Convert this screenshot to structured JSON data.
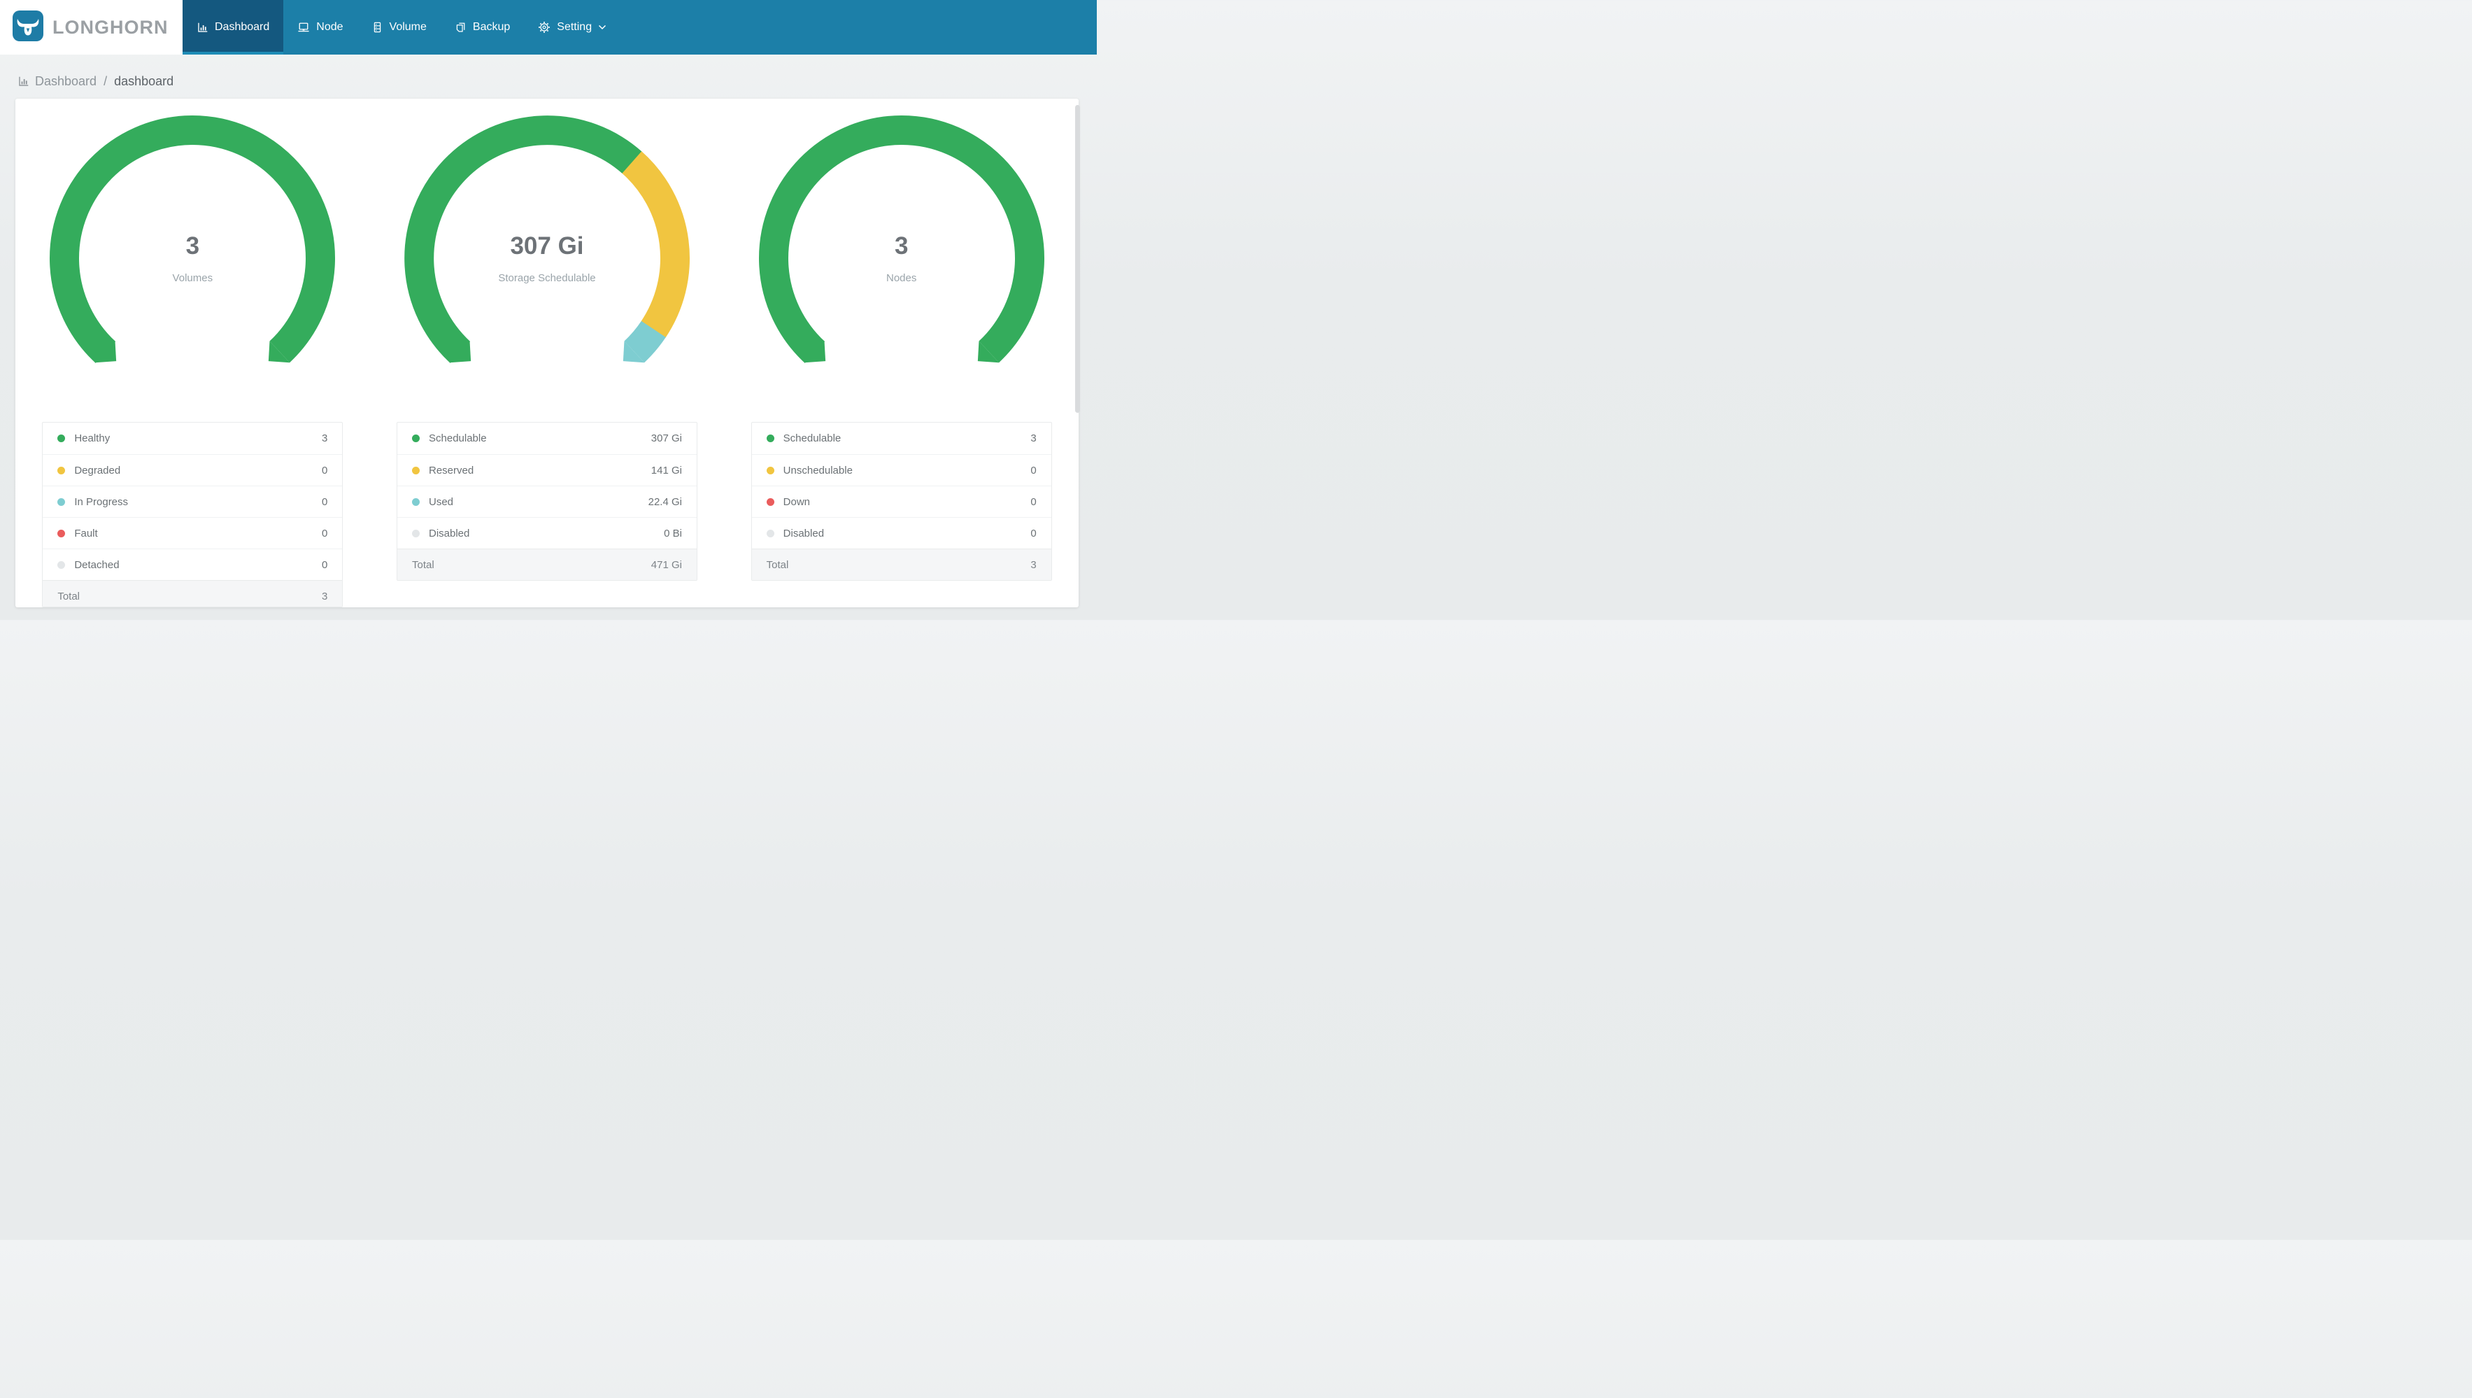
{
  "nav": {
    "brand": "LONGHORN",
    "items": [
      {
        "label": "Dashboard",
        "icon": "dashboard-bar-chart-icon",
        "active": true,
        "dropdown": false
      },
      {
        "label": "Node",
        "icon": "node-laptop-icon",
        "active": false,
        "dropdown": false
      },
      {
        "label": "Volume",
        "icon": "volume-server-icon",
        "active": false,
        "dropdown": false
      },
      {
        "label": "Backup",
        "icon": "backup-copy-icon",
        "active": false,
        "dropdown": false
      },
      {
        "label": "Setting",
        "icon": "setting-gear-icon",
        "active": false,
        "dropdown": true
      }
    ]
  },
  "breadcrumb": {
    "icon": "dashboard-bar-chart-icon",
    "section": "Dashboard",
    "separator": "/",
    "current": "dashboard"
  },
  "chart_data": [
    {
      "type": "donut",
      "center_value": "3",
      "center_label": "Volumes",
      "arc": {
        "start_deg": 133,
        "sweep_deg": 274,
        "gap_position": "bottom"
      },
      "segments": [
        {
          "label": "Healthy",
          "value": 3,
          "display": "3",
          "color": "#34ac5c"
        },
        {
          "label": "Degraded",
          "value": 0,
          "display": "0",
          "color": "#f1c540"
        },
        {
          "label": "In Progress",
          "value": 0,
          "display": "0",
          "color": "#7ecdd1"
        },
        {
          "label": "Fault",
          "value": 0,
          "display": "0",
          "color": "#ea5c5c"
        },
        {
          "label": "Detached",
          "value": 0,
          "display": "0",
          "color": "#e3e6e8"
        }
      ],
      "total": {
        "label": "Total",
        "display": "3"
      }
    },
    {
      "type": "donut",
      "center_value": "307 Gi",
      "center_label": "Storage Schedulable",
      "arc": {
        "start_deg": 133,
        "sweep_deg": 274,
        "gap_position": "bottom"
      },
      "segments": [
        {
          "label": "Schedulable",
          "value": 307,
          "display": "307 Gi",
          "color": "#34ac5c"
        },
        {
          "label": "Reserved",
          "value": 141,
          "display": "141 Gi",
          "color": "#f1c540"
        },
        {
          "label": "Used",
          "value": 22.4,
          "display": "22.4 Gi",
          "color": "#7ecdd1"
        },
        {
          "label": "Disabled",
          "value": 0,
          "display": "0 Bi",
          "color": "#e3e6e8"
        }
      ],
      "total": {
        "label": "Total",
        "display": "471 Gi"
      }
    },
    {
      "type": "donut",
      "center_value": "3",
      "center_label": "Nodes",
      "arc": {
        "start_deg": 133,
        "sweep_deg": 274,
        "gap_position": "bottom"
      },
      "segments": [
        {
          "label": "Schedulable",
          "value": 3,
          "display": "3",
          "color": "#34ac5c"
        },
        {
          "label": "Unschedulable",
          "value": 0,
          "display": "0",
          "color": "#f1c540"
        },
        {
          "label": "Down",
          "value": 0,
          "display": "0",
          "color": "#ea5c5c"
        },
        {
          "label": "Disabled",
          "value": 0,
          "display": "0",
          "color": "#e3e6e8"
        }
      ],
      "total": {
        "label": "Total",
        "display": "3"
      }
    }
  ],
  "colors": {
    "navbar": "#1c7fa8",
    "navbar_active": "#14587f",
    "active_underline": "#1e8cb6",
    "brand_text": "#9ba0a4",
    "logo_blue": "#1e7ca6",
    "page_background": "#e9eced",
    "green": "#34ac5c",
    "yellow": "#f1c540",
    "teal": "#7ecdd1",
    "red": "#ea5c5c",
    "gray": "#e3e6e8"
  }
}
